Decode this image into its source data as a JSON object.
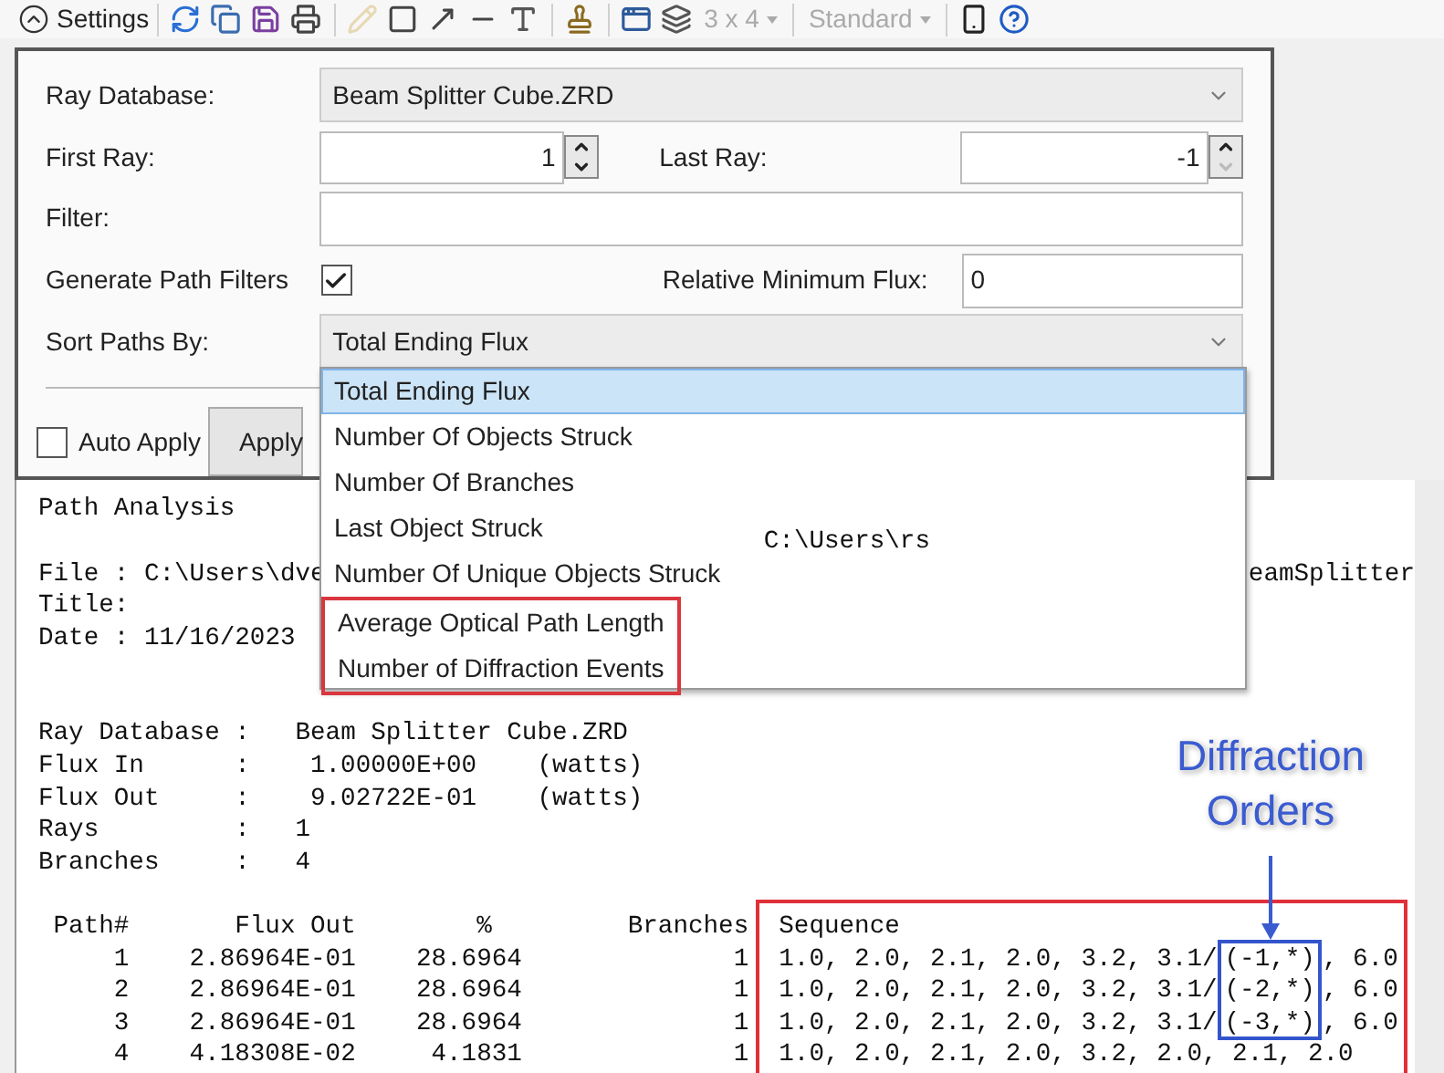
{
  "toolbar": {
    "settings_label": "Settings",
    "tools_a": [
      {
        "disabled": false
      },
      {
        "disabled": false
      },
      {
        "disabled": false
      },
      {
        "disabled": false
      }
    ],
    "tools_b": [
      {
        "disabled": true
      },
      {
        "disabled": false
      },
      {
        "disabled": false
      },
      {
        "disabled": false
      },
      {
        "disabled": false
      }
    ],
    "tools_c": [
      {
        "disabled": false
      }
    ],
    "tools_d": [
      {
        "disabled": false
      },
      {
        "disabled": false
      }
    ],
    "grid_menu": {
      "label": "3 x 4",
      "disabled": true
    },
    "style_menu": {
      "label": "Standard",
      "disabled": true
    },
    "tools_e": [
      {
        "disabled": false
      },
      {
        "disabled": false
      }
    ]
  },
  "settings": {
    "ray_database": {
      "label": "Ray Database:",
      "value": "Beam Splitter Cube.ZRD"
    },
    "first_ray": {
      "label": "First Ray:",
      "value": "1",
      "decrement_disabled": false
    },
    "last_ray": {
      "label": "Last Ray:",
      "value": "-1",
      "decrement_disabled": true
    },
    "filter": {
      "label": "Filter:"
    },
    "generate_path_filters": {
      "label": "Generate Path Filters",
      "checked": true
    },
    "relative_minimum_flux": {
      "label": "Relative Minimum Flux:",
      "value": "0"
    },
    "sort_paths_by": {
      "label": "Sort Paths By:",
      "value": "Total Ending Flux",
      "expanded": true,
      "options": [
        {
          "label": "Total Ending Flux",
          "selected": true,
          "highlighted": false
        },
        {
          "label": "Number Of Objects Struck",
          "selected": false,
          "highlighted": false
        },
        {
          "label": "Number Of Branches",
          "selected": false,
          "highlighted": false
        },
        {
          "label": "Last Object Struck",
          "selected": false,
          "highlighted": false
        },
        {
          "label": "Number Of Unique Objects Struck",
          "selected": false,
          "highlighted": false
        },
        {
          "label": "Average Optical Path Length",
          "selected": false,
          "highlighted": true
        },
        {
          "label": "Number of Diffraction Events",
          "selected": false,
          "highlighted": true
        }
      ]
    },
    "auto_apply": {
      "label": "Auto Apply",
      "checked": false
    },
    "apply_button": "Apply"
  },
  "report": {
    "title": "Path Analysis",
    "path_fragment": "C:\\Users\\rs",
    "file_label": "File : C:\\Users\\dve",
    "file_tail": "eamSplitter",
    "title_label": "Title:",
    "date": "Date : 11/16/2023",
    "summary": [
      {
        "label": "Ray Database",
        "separator": ":",
        "value": "Beam Splitter Cube.ZRD"
      },
      {
        "label": "Flux In",
        "separator": ":",
        "value": "1.00000E+00",
        "unit": "(watts)"
      },
      {
        "label": "Flux Out",
        "separator": ":",
        "value": "9.02722E-01",
        "unit": "(watts)"
      },
      {
        "label": "Rays",
        "separator": ":",
        "value": "1"
      },
      {
        "label": "Branches",
        "separator": ":",
        "value": "4"
      }
    ],
    "columns": [
      "Path#",
      "Flux Out",
      "%",
      "Branches",
      "Sequence"
    ],
    "rows": [
      {
        "path": "1",
        "flux_out": "2.86964E-01",
        "percent": "28.6964",
        "branches": "1",
        "sequence": "1.0, 2.0, 2.1, 2.0, 3.2, 3.1/",
        "order": "(-1,*)",
        "sequence_end": ", 6.0"
      },
      {
        "path": "2",
        "flux_out": "2.86964E-01",
        "percent": "28.6964",
        "branches": "1",
        "sequence": "1.0, 2.0, 2.1, 2.0, 3.2, 3.1/",
        "order": "(-2,*)",
        "sequence_end": ", 6.0"
      },
      {
        "path": "3",
        "flux_out": "2.86964E-01",
        "percent": "28.6964",
        "branches": "1",
        "sequence": "1.0, 2.0, 2.1, 2.0, 3.2, 3.1/",
        "order": "(-3,*)",
        "sequence_end": ", 6.0"
      },
      {
        "path": "4",
        "flux_out": "4.18308E-02",
        "percent": "4.1831",
        "branches": "1",
        "sequence": "1.0, 2.0, 2.1, 2.0, 3.2, 2.0, 2.1, 2.0"
      }
    ],
    "annotation": {
      "label": "Diffraction Orders"
    }
  }
}
